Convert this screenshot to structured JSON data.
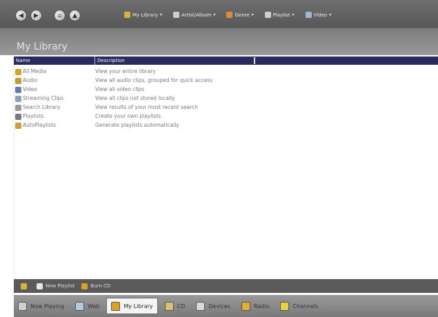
{
  "toolbar": {
    "menus": [
      {
        "label": "My Library",
        "color": "#d8b23a"
      },
      {
        "label": "Artist/Album",
        "color": "#cfcfcf"
      },
      {
        "label": "Genre",
        "color": "#e08a3c"
      },
      {
        "label": "Playlist",
        "color": "#cfcfcf"
      },
      {
        "label": "Video",
        "color": "#9fb8d8"
      }
    ],
    "menu_arrow": "▾"
  },
  "page_title": "My Library",
  "columns": {
    "name": "Name",
    "description": "Description"
  },
  "rows": [
    {
      "name": "All Media",
      "description": "View your entire library",
      "icon": "all-media",
      "color": "#d6a22a"
    },
    {
      "name": "Audio",
      "description": "View all audio clips, grouped for quick access",
      "icon": "audio",
      "color": "#c89a30"
    },
    {
      "name": "Video",
      "description": "View all video clips",
      "icon": "video",
      "color": "#6a7aa8"
    },
    {
      "name": "Streaming Clips",
      "description": "View all clips not stored locally",
      "icon": "streaming",
      "color": "#8aa0c0"
    },
    {
      "name": "Search Library",
      "description": "View results of your most recent search",
      "icon": "search",
      "color": "#9a9a9a"
    },
    {
      "name": "Playlists",
      "description": "Create your own playlists",
      "icon": "playlist",
      "color": "#7a7a7a"
    },
    {
      "name": "AutoPlaylists",
      "description": "Generate playlists automatically",
      "icon": "autoplaylist",
      "color": "#c8a040"
    }
  ],
  "actions": [
    {
      "label": "",
      "color": "#d8b23a"
    },
    {
      "label": "New Playlist",
      "color": "#e8e8e8"
    },
    {
      "label": "Burn CD",
      "color": "#e0a020"
    }
  ],
  "tabs": [
    {
      "label": "Now Playing",
      "active": false,
      "color": "#cfcfcf"
    },
    {
      "label": "Web",
      "active": false,
      "color": "#b8c8e0"
    },
    {
      "label": "My Library",
      "active": true,
      "color": "#e0a020"
    },
    {
      "label": "CD",
      "active": false,
      "color": "#d8c070"
    },
    {
      "label": "Devices",
      "active": false,
      "color": "#d8d8d8"
    },
    {
      "label": "Radio",
      "active": false,
      "color": "#e0b030"
    },
    {
      "label": "Channels",
      "active": false,
      "color": "#e8d040"
    }
  ]
}
